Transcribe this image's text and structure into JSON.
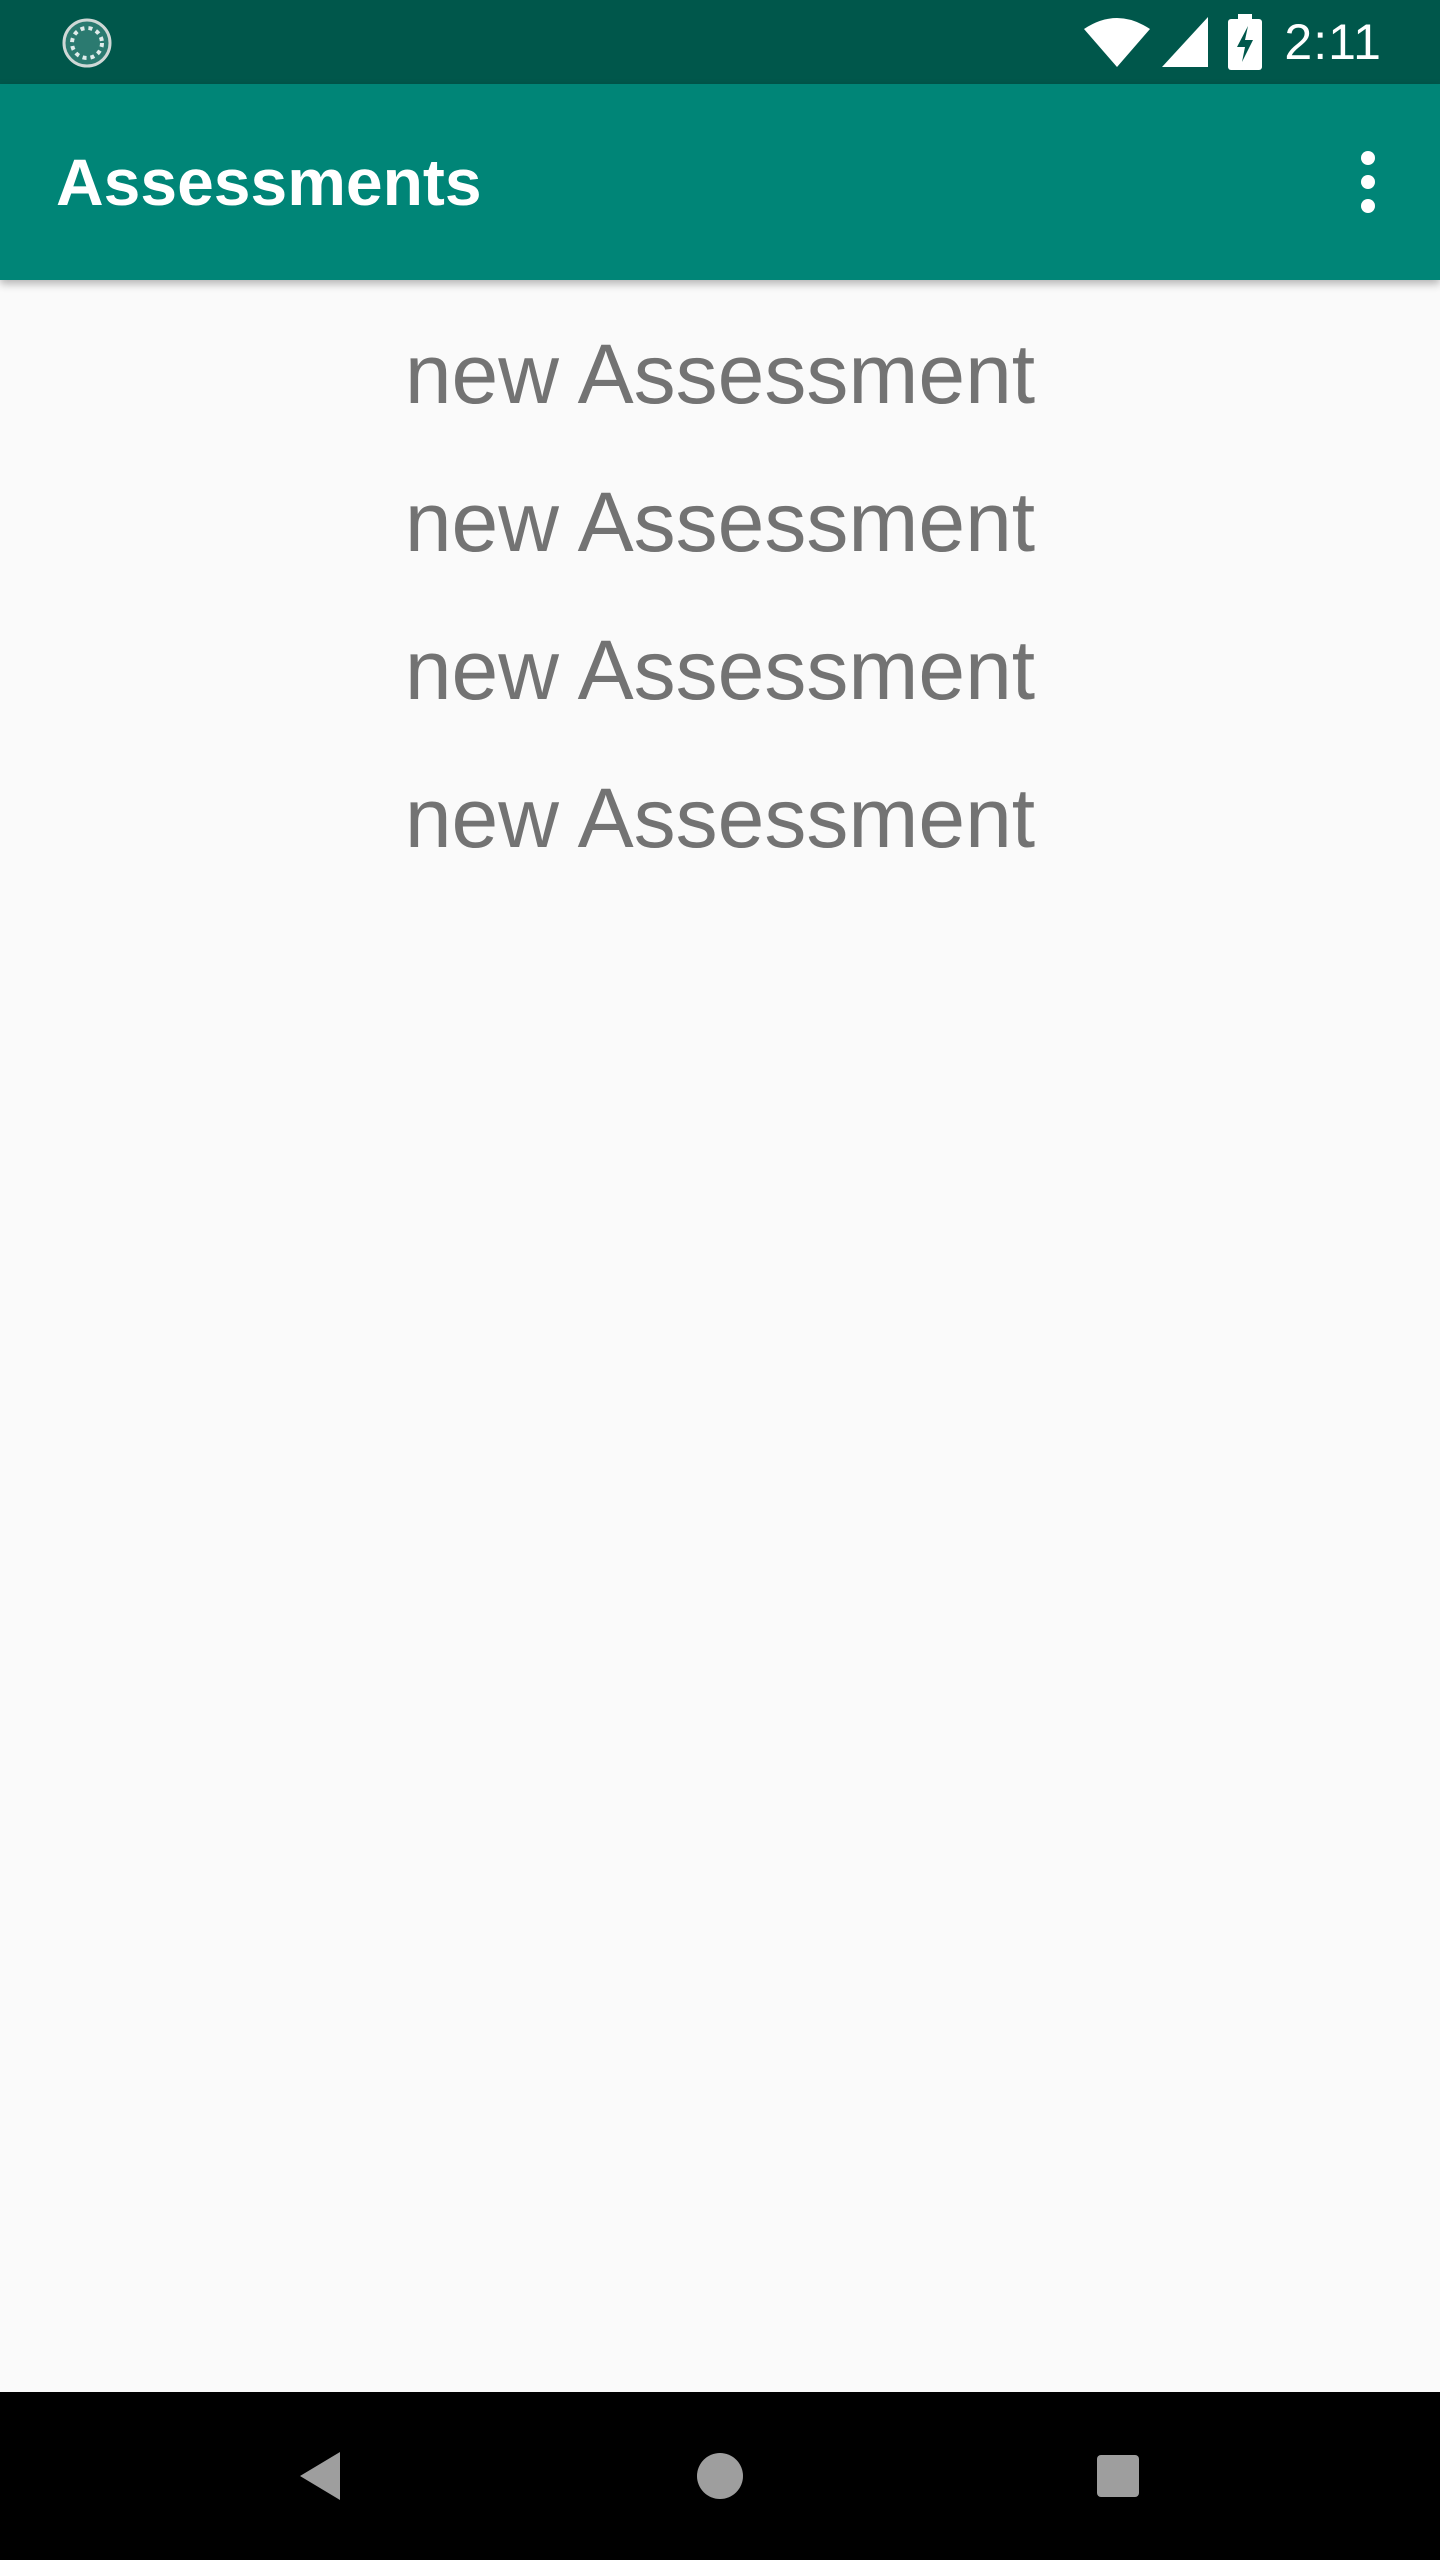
{
  "status_bar": {
    "time": "2:11",
    "icons": [
      "loading-icon",
      "wifi-icon",
      "cell-signal-icon",
      "battery-charging-icon"
    ]
  },
  "app_bar": {
    "title": "Assessments",
    "menu_icon": "more-vert-icon"
  },
  "assessments": [
    {
      "label": "new Assessment"
    },
    {
      "label": "new Assessment"
    },
    {
      "label": "new Assessment"
    },
    {
      "label": "new Assessment"
    }
  ],
  "nav_bar": {
    "buttons": [
      "back-icon",
      "home-icon",
      "recents-icon"
    ]
  },
  "colors": {
    "status_bar": "#00574b",
    "app_bar": "#008577",
    "background": "#fafafa",
    "list_text": "#737373",
    "nav_bar": "#000000"
  }
}
